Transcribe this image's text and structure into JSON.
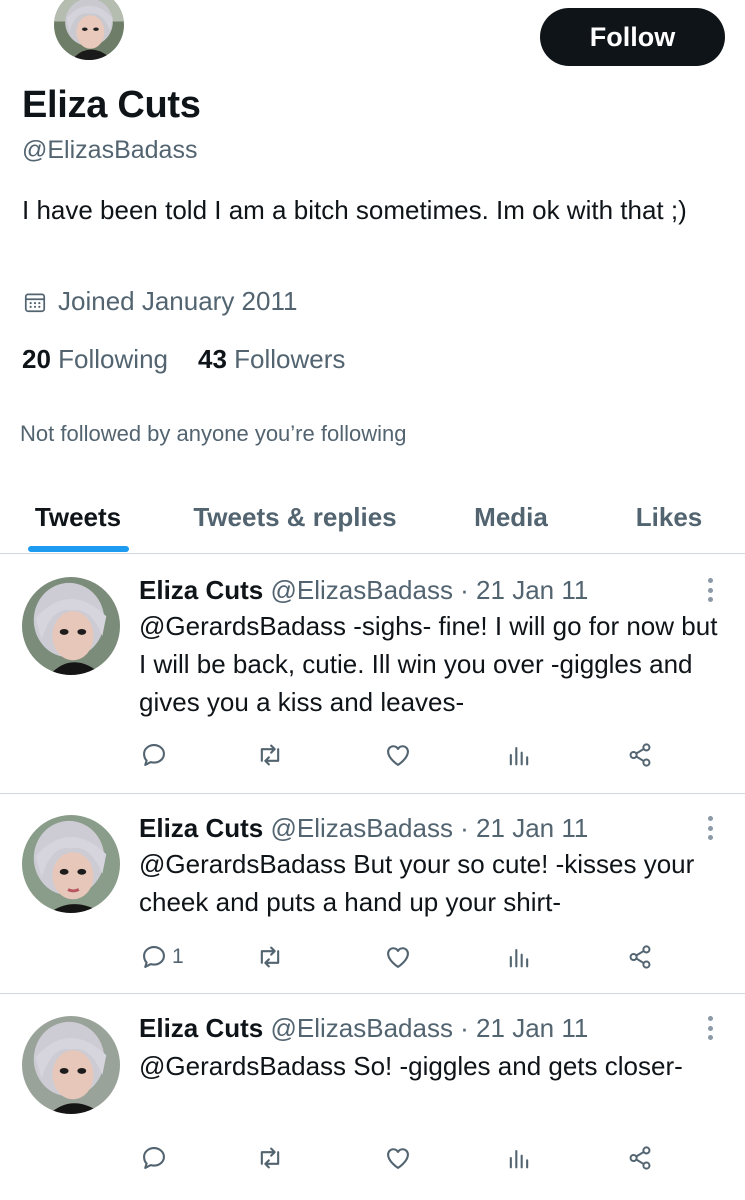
{
  "profile": {
    "display_name": "Eliza Cuts",
    "handle": "@ElizasBadass",
    "bio": "I have been told I am a bitch sometimes. Im ok with that ;)",
    "joined": "Joined January 2011",
    "following_count": "20",
    "following_label": "Following",
    "followers_count": "43",
    "followers_label": "Followers",
    "not_followed": "Not followed by anyone you’re following",
    "follow_label": "Follow"
  },
  "tabs": [
    {
      "label": "Tweets",
      "active": true
    },
    {
      "label": "Tweets & replies",
      "active": false
    },
    {
      "label": "Media",
      "active": false
    },
    {
      "label": "Likes",
      "active": false
    }
  ],
  "tweets": [
    {
      "name": "Eliza Cuts",
      "meta": "@ElizasBadass · 21 Jan 11",
      "text": "@GerardsBadass -sighs- fine! I will go for now but I will be back, cutie. Ill win you over -giggles and gives you a kiss and leaves-",
      "reply_count": ""
    },
    {
      "name": "Eliza Cuts",
      "meta": "@ElizasBadass · 21 Jan 11",
      "text": "@GerardsBadass But your so cute! -kisses your cheek and puts a hand up your shirt-",
      "reply_count": "1"
    },
    {
      "name": "Eliza Cuts",
      "meta": "@ElizasBadass · 21 Jan 11",
      "text": "@GerardsBadass So! -giggles and gets closer-",
      "reply_count": ""
    }
  ],
  "icons": {
    "calendar": "calendar-icon",
    "reply": "reply-icon",
    "retweet": "retweet-icon",
    "like": "heart-icon",
    "views": "views-icon",
    "share": "share-icon",
    "more": "more-icon"
  },
  "colors": {
    "accent": "#1d9bf0",
    "text": "#0f1419",
    "muted": "#536471",
    "border": "#cfd9de",
    "button": "#0f1419"
  }
}
